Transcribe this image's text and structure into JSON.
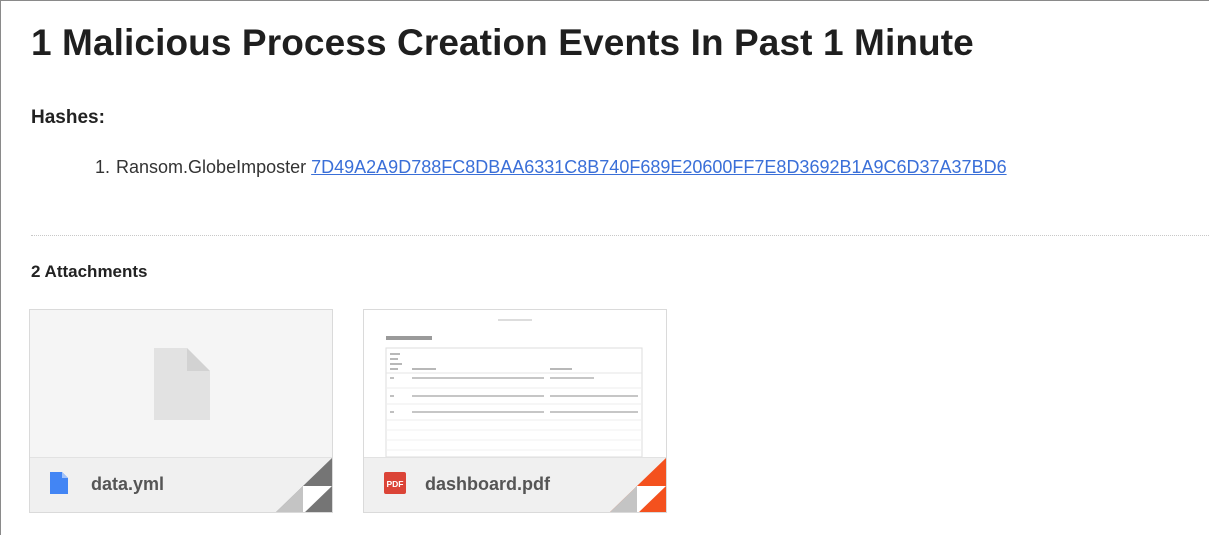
{
  "title": "1 Malicious Process Creation Events In Past 1 Minute",
  "hashes": {
    "label": "Hashes:",
    "items": [
      {
        "number": "1.",
        "name": "Ransom.GlobeImposter",
        "hash": "7D49A2A9D788FC8DBAA6331C8B740F689E20600FF7E8D3692B1A9C6D37A37BD6"
      }
    ]
  },
  "attachments": {
    "heading": "2 Attachments",
    "items": [
      {
        "name": "data.yml",
        "icon": "document-icon",
        "accent": "#4285f4",
        "fold_color": "#757575"
      },
      {
        "name": "dashboard.pdf",
        "icon": "pdf-icon",
        "icon_text": "PDF",
        "accent": "#db4437",
        "fold_color": "#f4511e"
      }
    ]
  },
  "colors": {
    "link": "#3a6fd8",
    "pdf_red": "#db4437",
    "doc_blue": "#4285f4"
  }
}
